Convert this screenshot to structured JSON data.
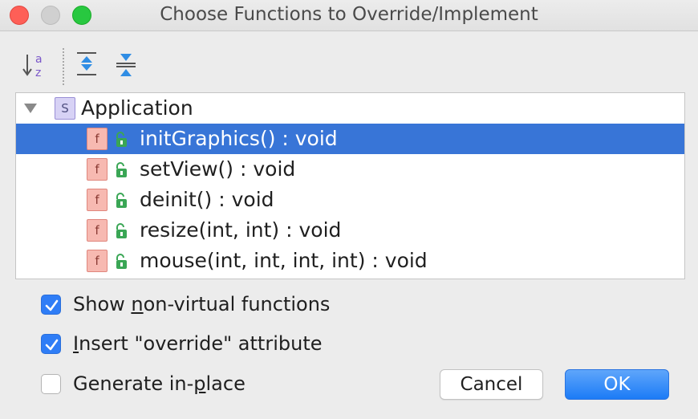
{
  "window": {
    "title": "Choose Functions to Override/Implement"
  },
  "toolbar": {
    "sort_icon": "sort-alphabetically-icon",
    "expand_icon": "expand-all-icon",
    "collapse_icon": "collapse-all-icon"
  },
  "tree": {
    "root": {
      "badge": "S",
      "label": "Application",
      "expanded": true
    },
    "items": [
      {
        "badge": "f",
        "label": "initGraphics() : void",
        "selected": true
      },
      {
        "badge": "f",
        "label": "setView() : void",
        "selected": false
      },
      {
        "badge": "f",
        "label": "deinit() : void",
        "selected": false
      },
      {
        "badge": "f",
        "label": "resize(int, int) : void",
        "selected": false
      },
      {
        "badge": "f",
        "label": "mouse(int, int, int, int) : void",
        "selected": false
      }
    ]
  },
  "options": [
    {
      "label_before": "Show ",
      "mnemonic": "n",
      "label_after": "on-virtual functions",
      "checked": true
    },
    {
      "label_before": "",
      "mnemonic": "I",
      "label_after": "nsert \"override\" attribute",
      "checked": true
    },
    {
      "label_before": "Generate in-",
      "mnemonic": "p",
      "label_after": "lace",
      "checked": false
    }
  ],
  "buttons": {
    "cancel": "Cancel",
    "ok": "OK"
  },
  "colors": {
    "selection": "#3875d7",
    "checkbox_on": "#2f7df6",
    "ok_button": "#1c7bf6"
  }
}
